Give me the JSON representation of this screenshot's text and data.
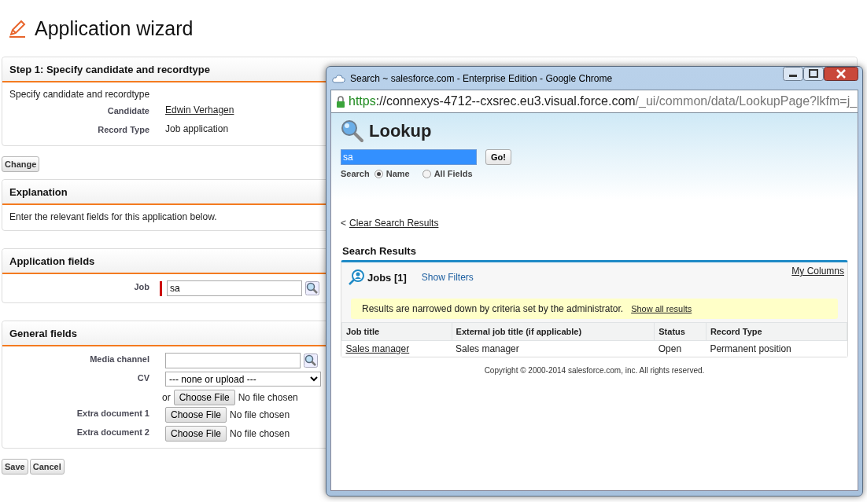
{
  "page": {
    "title": "Application wizard"
  },
  "sections": [
    {
      "title": "Step 1: Specify candidate and recordtype",
      "intro": "Specify candidate and recordtype",
      "fields": [
        {
          "label": "Candidate",
          "kind": "link",
          "value": "Edwin Verhagen"
        },
        {
          "label": "Record Type",
          "kind": "text",
          "value": "Job application"
        }
      ],
      "buttons": [
        "Change"
      ]
    },
    {
      "title": "Explanation",
      "intro": "Enter the relevant fields for this application below."
    },
    {
      "title": "Application fields",
      "fields": [
        {
          "label": "Job",
          "kind": "lookup",
          "value": "sa",
          "required": true
        }
      ]
    },
    {
      "title": "General fields",
      "fields": [
        {
          "label": "Media channel",
          "kind": "lookup",
          "required": false
        },
        {
          "label": "CV",
          "kind": "select_upload",
          "selected_option": "--- none or upload ---",
          "or_text": "or",
          "file_button": "Choose File",
          "file_status": "No file chosen"
        },
        {
          "label": "Extra document 1",
          "kind": "file",
          "file_button": "Choose File",
          "file_status": "No file chosen"
        },
        {
          "label": "Extra document 2",
          "kind": "file",
          "file_button": "Choose File",
          "file_status": "No file chosen"
        }
      ],
      "buttons": [
        "Save",
        "Cancel"
      ]
    }
  ],
  "popup": {
    "title": "Search ~ salesforce.com - Enterprise Edition - Google Chrome",
    "url": {
      "scheme": "https",
      "host": "://connexys-4712--cxsrec.eu3.visual.force.com",
      "path": "/_ui/common/data/LookupPage?lkfm=j_"
    },
    "heading": "Lookup",
    "search_value": "sa",
    "go_button": "Go!",
    "search_label": "Search",
    "scope": [
      {
        "label": "Name",
        "selected": true
      },
      {
        "label": "All Fields",
        "selected": false
      }
    ],
    "clear_prefix": "<",
    "clear_link": "Clear Search Results",
    "results_title": "Search Results",
    "list": {
      "title": "Jobs [1]",
      "show_filters": "Show Filters",
      "my_columns": "My Columns",
      "notice": "Results are narrowed down by criteria set by the administrator.",
      "notice_link": "Show all results",
      "columns": [
        "Job title",
        "External job title (if applicable)",
        "Status",
        "Record Type"
      ],
      "rows": [
        {
          "cells": [
            "Sales manager",
            "Sales manager",
            "Open",
            "Permanent position"
          ]
        }
      ]
    },
    "copyright": "Copyright © 2000-2014 salesforce.com, inc. All rights reserved."
  }
}
